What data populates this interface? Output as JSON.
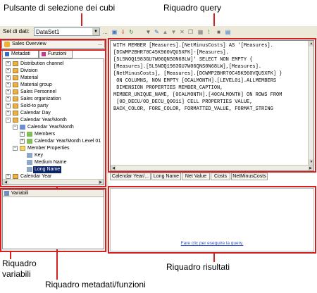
{
  "callouts": {
    "cube_selector": "Pulsante di selezione dei cubi",
    "query_pane": "Riquadro query",
    "variables_pane": "Riquadro\nvariabili",
    "metadata_pane": "Riquadro metadati/funzioni",
    "results_pane": "Riquadro risultati"
  },
  "toolbar": {
    "dataset_label": "Set di dati:",
    "dataset_value": "DataSet1",
    "ellipsis": "..."
  },
  "cube": {
    "name": "Sales Overview",
    "ellipsis": "..."
  },
  "tabs": {
    "metadata": "Metadati",
    "functions": "Funzioni"
  },
  "tree": [
    "Distribution channel",
    "Division",
    "Material",
    "Material group",
    "Sales Personnel",
    "Sales organization",
    "Sold-to party",
    "Calendar Day",
    "Calendar Year/Month",
    "Calendar Year/Month",
    "Members",
    "Calendar Year/Month Level 01",
    "Member Properties",
    "Key",
    "Medium Name",
    "Long Name",
    "Calendar Year"
  ],
  "variables": {
    "title": "Variabili"
  },
  "query_lines": [
    "WITH MEMBER [Measures].[NetMinusCosts] AS '[Measures].",
    "[DCWMP2BHR70C45K960VQU5XFK]-[Measures].",
    "[5L5NOQ1983GU7W06QNS0N68LW]' SELECT NON EMPTY {",
    "[Measures].[5L5NOQ1983GU7W06QNS0N68LW],[Measures].",
    "[NetMinusCosts], [Measures].[DCWMP2BHR70C45K960VQU5XFK] }",
    " ON COLUMNS, NON EMPTY [0CALMONTH].[LEVEL01].ALLMEMBERS",
    " DIMENSION PROPERTIES MEMBER_CAPTION,",
    "MEMBER_UNIQUE_NAME, [0CALMONTH].[40CALMONTH] ON ROWS FROM",
    " [0D_DECU/0D_DECU_Q0011] CELL PROPERTIES VALUE,",
    "BACK_COLOR, FORE_COLOR, FORMATTED_VALUE, FORMAT_STRING"
  ],
  "result_columns": [
    "Calendar Year/...",
    "Long Name",
    "Net Value",
    "Costs",
    "NetMinusCosts"
  ],
  "result_link": "Fare clic per eseguire la query.",
  "colors": {
    "accent_red": "#d42020",
    "selection": "#0a246a",
    "link": "#2b4fd0"
  }
}
